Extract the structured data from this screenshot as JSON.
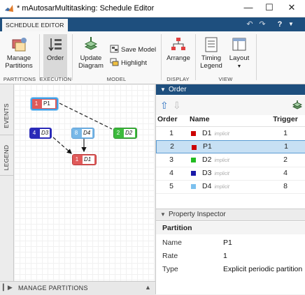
{
  "window": {
    "title": "* mAutosarMultitasking: Schedule Editor",
    "minimize_icon": "minimize-icon",
    "maximize_icon": "maximize-icon",
    "close_icon": "close-icon"
  },
  "tabstrip": {
    "active_tab": "SCHEDULE EDITOR",
    "quick_access": [
      "undo-icon",
      "redo-icon",
      "help-icon"
    ]
  },
  "ribbon": {
    "manage_partitions": "Manage Partitions",
    "order": "Order",
    "update_diagram": "Update Diagram",
    "save_model": "Save Model",
    "highlight": "Highlight",
    "arrange": "Arrange",
    "timing_legend": "Timing Legend",
    "layout": "Layout",
    "groups": {
      "partitions": "PARTITIONS",
      "execution": "EXECUTION",
      "model": "MODEL",
      "display": "DISPLAY",
      "view": "VIEW"
    }
  },
  "side_tabs": {
    "events": "EVENTS",
    "legend": "LEGEND"
  },
  "canvas": {
    "blocks": [
      {
        "num": "1",
        "name": "P1",
        "color": "#e05a5a",
        "selected": true
      },
      {
        "num": "4",
        "name": "D3",
        "color": "#2a2ab8"
      },
      {
        "num": "8",
        "name": "D4",
        "color": "#78b8e8"
      },
      {
        "num": "2",
        "name": "D2",
        "color": "#3dbb3d"
      },
      {
        "num": "1",
        "name": "D1",
        "color": "#e05a5a"
      }
    ]
  },
  "bottom_bar": {
    "label": "MANAGE PARTITIONS"
  },
  "order_panel": {
    "title": "Order",
    "columns": {
      "order": "Order",
      "name": "Name",
      "trigger": "Trigger"
    },
    "rows": [
      {
        "order": "1",
        "name": "D1",
        "implicit": "implicit",
        "trigger": "1",
        "color": "#cc0000"
      },
      {
        "order": "2",
        "name": "P1",
        "implicit": "",
        "trigger": "1",
        "color": "#cc0000",
        "selected": true
      },
      {
        "order": "3",
        "name": "D2",
        "implicit": "implicit",
        "trigger": "2",
        "color": "#22bb22"
      },
      {
        "order": "4",
        "name": "D3",
        "implicit": "implicit",
        "trigger": "4",
        "color": "#1a1aa8"
      },
      {
        "order": "5",
        "name": "D4",
        "implicit": "implicit",
        "trigger": "8",
        "color": "#7cc0ee"
      }
    ]
  },
  "property_inspector": {
    "title": "Property Inspector",
    "category": "Partition",
    "props": [
      {
        "key": "Name",
        "value": "P1"
      },
      {
        "key": "Rate",
        "value": "1"
      },
      {
        "key": "Type",
        "value": "Explicit periodic partition"
      }
    ]
  }
}
